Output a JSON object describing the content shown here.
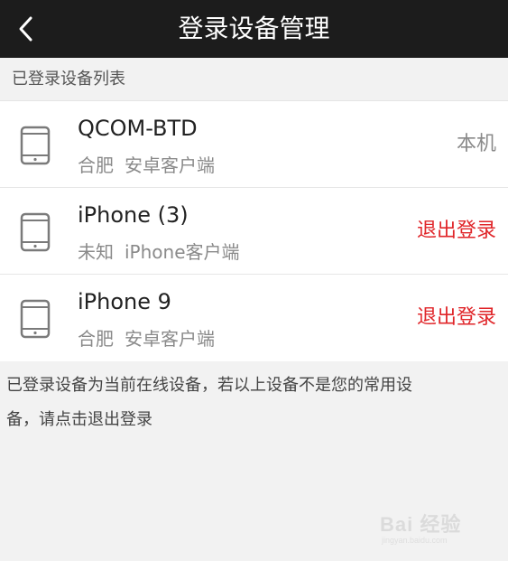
{
  "header": {
    "title": "登录设备管理"
  },
  "section": {
    "title": "已登录设备列表"
  },
  "devices": [
    {
      "name": "QCOM-BTD",
      "location": "合肥",
      "client": "安卓客户端",
      "action": "本机"
    },
    {
      "name": "iPhone (3)",
      "location": "未知",
      "client": "iPhone客户端",
      "action": "退出登录"
    },
    {
      "name": "iPhone 9",
      "location": "合肥",
      "client": "安卓客户端",
      "action": "退出登录"
    }
  ],
  "footer": {
    "note": "已登录设备为当前在线设备，若以上设备不是您的常用设备，请点击退出登录"
  },
  "watermark": {
    "brand": "Bai 经验",
    "sub": "jingyan.baidu.com"
  },
  "colors": {
    "header_bg": "#1c1c1c",
    "logout": "#e0262a",
    "background": "#f2f2f2"
  },
  "icons": {
    "back": "chevron-left-icon",
    "device": "phone-icon"
  }
}
